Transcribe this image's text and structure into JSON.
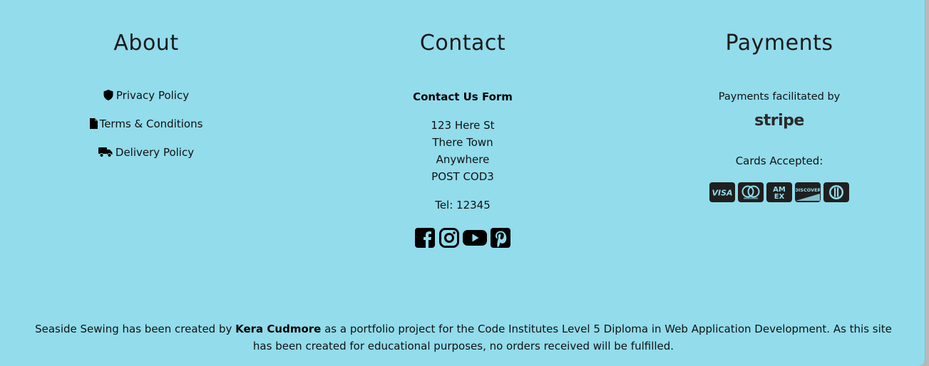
{
  "about": {
    "heading": "About",
    "links": [
      {
        "label": "Privacy Policy",
        "icon": "shield-icon"
      },
      {
        "label": "Terms & Conditions",
        "icon": "file-icon"
      },
      {
        "label": "Delivery Policy",
        "icon": "truck-icon"
      }
    ]
  },
  "contact": {
    "heading": "Contact",
    "form_link": "Contact Us Form",
    "address": [
      "123 Here St",
      "There Town",
      "Anywhere",
      "POST COD3"
    ],
    "tel": "Tel: 12345",
    "social": [
      "facebook-icon",
      "instagram-icon",
      "youtube-icon",
      "pinterest-icon"
    ]
  },
  "payments": {
    "heading": "Payments",
    "facilitated": "Payments facilitated by",
    "stripe": "stripe",
    "cards_label": "Cards Accepted:",
    "cards": [
      "visa-icon",
      "mastercard-icon",
      "amex-icon",
      "discover-icon",
      "diners-club-icon"
    ]
  },
  "footer_note": {
    "before": "Seaside Sewing has been created by ",
    "author": "Kera Cudmore",
    "after": " as a portfolio project for the Code Institutes Level 5 Diploma in Web Application Development. As this site has been created for educational purposes, no orders received will be fulfilled."
  },
  "colors": {
    "background": "#92dcec",
    "text": "#111111"
  }
}
